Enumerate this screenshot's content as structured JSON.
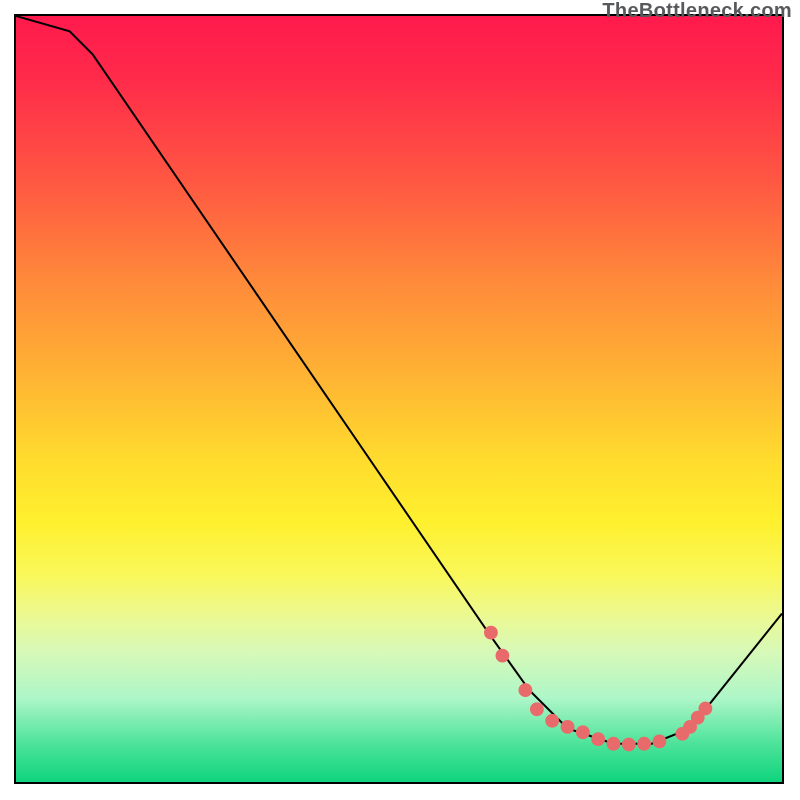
{
  "watermark": "TheBottleneck.com",
  "chart_data": {
    "type": "line",
    "title": "",
    "xlabel": "",
    "ylabel": "",
    "xlim": [
      0,
      100
    ],
    "ylim": [
      0,
      100
    ],
    "series": [
      {
        "name": "bottleneck-curve",
        "x": [
          0,
          7,
          10,
          62,
          67,
          72,
          78,
          83,
          88,
          100
        ],
        "y": [
          100,
          98,
          95,
          19,
          12,
          7,
          5,
          5,
          7,
          22
        ]
      }
    ],
    "markers": {
      "name": "optimal-zone-dots",
      "color": "#e96a6a",
      "points": [
        {
          "x": 62.0,
          "y": 19.5
        },
        {
          "x": 63.5,
          "y": 16.5
        },
        {
          "x": 66.5,
          "y": 12.0
        },
        {
          "x": 68.0,
          "y": 9.5
        },
        {
          "x": 70.0,
          "y": 8.0
        },
        {
          "x": 72.0,
          "y": 7.2
        },
        {
          "x": 74.0,
          "y": 6.5
        },
        {
          "x": 76.0,
          "y": 5.6
        },
        {
          "x": 78.0,
          "y": 5.0
        },
        {
          "x": 80.0,
          "y": 4.9
        },
        {
          "x": 82.0,
          "y": 5.0
        },
        {
          "x": 84.0,
          "y": 5.3
        },
        {
          "x": 87.0,
          "y": 6.3
        },
        {
          "x": 88.0,
          "y": 7.2
        },
        {
          "x": 89.0,
          "y": 8.4
        },
        {
          "x": 90.0,
          "y": 9.6
        }
      ]
    },
    "background_gradient": {
      "top": "#ff1a4d",
      "mid": "#ffe02e",
      "bottom": "#0fd47d"
    }
  }
}
